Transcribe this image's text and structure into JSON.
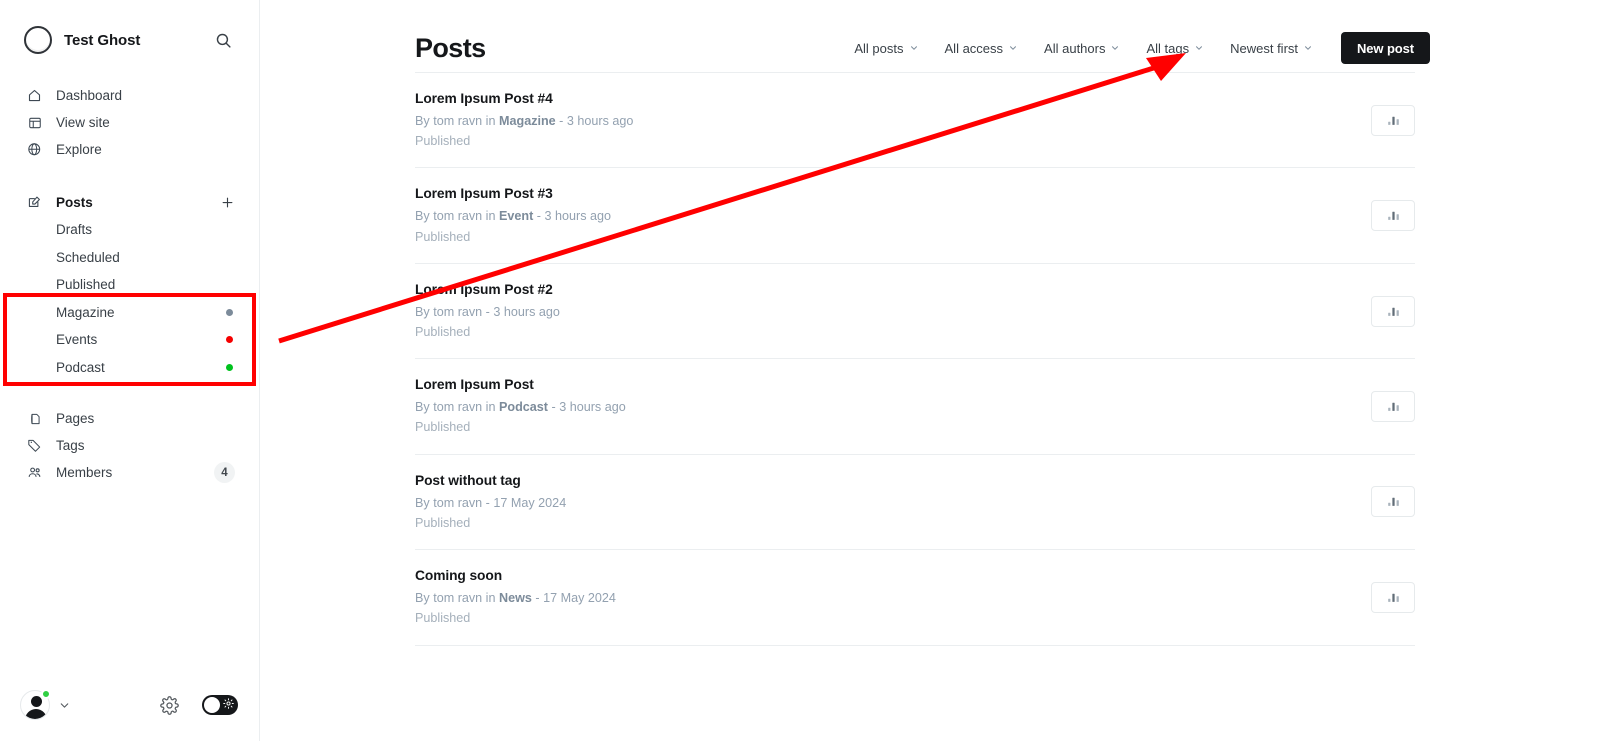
{
  "sidebar": {
    "brand": {
      "name": "Test Ghost",
      "logo_icon": "ghost-logo-icon",
      "search_icon": "search-icon"
    },
    "primary_nav": [
      {
        "label": "Dashboard",
        "icon": "home-icon"
      },
      {
        "label": "View site",
        "icon": "browser-icon"
      },
      {
        "label": "Explore",
        "icon": "globe-icon"
      }
    ],
    "posts_section": {
      "label": "Posts",
      "icon": "edit-icon",
      "add_icon": "plus-icon"
    },
    "posts_sub": [
      {
        "label": "Drafts",
        "dot": null
      },
      {
        "label": "Scheduled",
        "dot": null
      },
      {
        "label": "Published",
        "dot": null
      },
      {
        "label": "Magazine",
        "dot": "#7c8b9a"
      },
      {
        "label": "Events",
        "dot": "#f50000"
      },
      {
        "label": "Podcast",
        "dot": "#00c21e"
      }
    ],
    "secondary_nav": [
      {
        "label": "Pages",
        "icon": "pages-icon",
        "badge": null
      },
      {
        "label": "Tags",
        "icon": "tag-icon",
        "badge": null
      },
      {
        "label": "Members",
        "icon": "members-icon",
        "badge": "4"
      }
    ],
    "bottom": {
      "avatar_icon": "avatar",
      "status_icon": "online-dot",
      "chevron_icon": "chevron-down-icon",
      "settings_icon": "gear-icon",
      "theme_toggle_icon": "dark-mode-toggle"
    }
  },
  "header": {
    "title": "Posts",
    "filters": [
      {
        "label": "All posts",
        "chevron": "chevron-down-icon"
      },
      {
        "label": "All access",
        "chevron": "chevron-down-icon"
      },
      {
        "label": "All authors",
        "chevron": "chevron-down-icon"
      },
      {
        "label": "All tags",
        "chevron": "chevron-down-icon"
      },
      {
        "label": "Newest first",
        "chevron": "chevron-down-icon"
      }
    ],
    "new_post_label": "New post"
  },
  "posts": [
    {
      "title": "Lorem Ipsum Post #4",
      "author_prefix": "By tom ravn in ",
      "tag": "Magazine",
      "time": " - 3 hours ago",
      "status": "Published",
      "stats_icon": "bar-chart-icon"
    },
    {
      "title": "Lorem Ipsum Post #3",
      "author_prefix": "By tom ravn in ",
      "tag": "Event",
      "time": " - 3 hours ago",
      "status": "Published",
      "stats_icon": "bar-chart-icon"
    },
    {
      "title": "Lorem Ipsum Post #2",
      "author_prefix": "By tom ravn",
      "tag": "",
      "time": " - 3 hours ago",
      "status": "Published",
      "stats_icon": "bar-chart-icon"
    },
    {
      "title": "Lorem Ipsum Post",
      "author_prefix": "By tom ravn in ",
      "tag": "Podcast",
      "time": " - 3 hours ago",
      "status": "Published",
      "stats_icon": "bar-chart-icon"
    },
    {
      "title": "Post without tag",
      "author_prefix": "By tom ravn",
      "tag": "",
      "time": " - 17 May 2024",
      "status": "Published",
      "stats_icon": "bar-chart-icon"
    },
    {
      "title": "Coming soon",
      "author_prefix": "By tom ravn in ",
      "tag": "News",
      "time": " - 17 May 2024",
      "status": "Published",
      "stats_icon": "bar-chart-icon"
    }
  ],
  "annotations": {
    "highlight_color": "#ff0000",
    "box_target": "sidebar tag list: Magazine, Events, Podcast",
    "arrow_target": "All tags filter"
  }
}
